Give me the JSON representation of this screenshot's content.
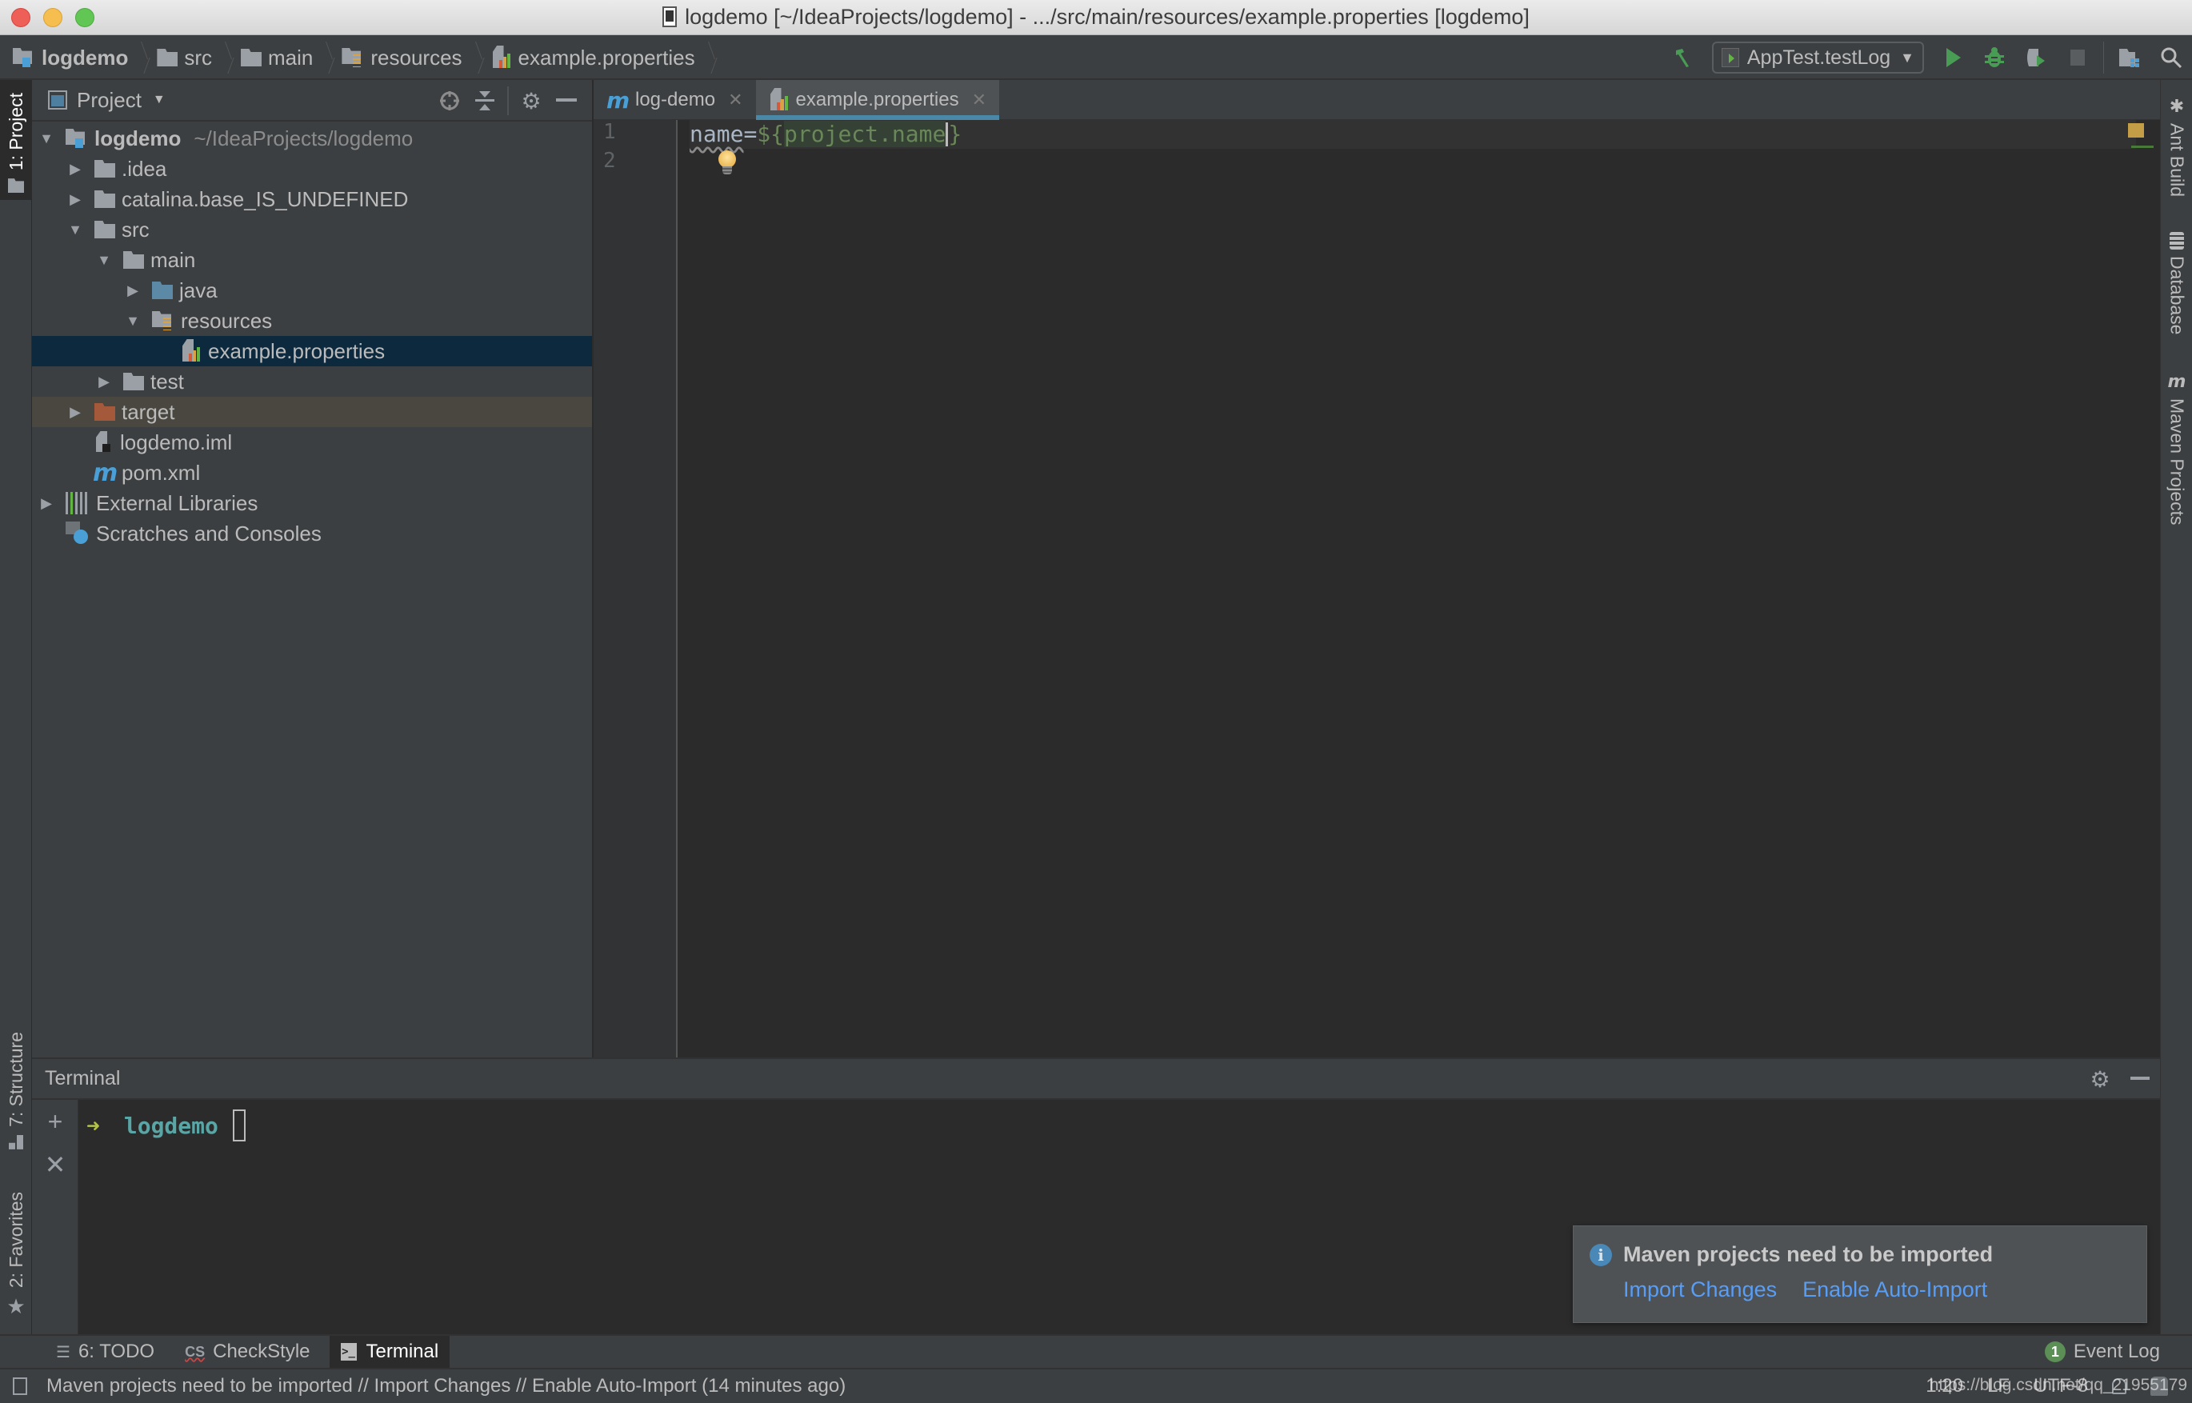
{
  "window": {
    "title": "logdemo [~/IdeaProjects/logdemo] - .../src/main/resources/example.properties [logdemo]"
  },
  "navbar": {
    "breadcrumbs": [
      {
        "label": "logdemo",
        "icon": "module-folder-icon"
      },
      {
        "label": "src",
        "icon": "folder-icon"
      },
      {
        "label": "main",
        "icon": "folder-icon"
      },
      {
        "label": "resources",
        "icon": "resources-folder-icon"
      },
      {
        "label": "example.properties",
        "icon": "properties-file-icon"
      }
    ],
    "run_config": "AppTest.testLog",
    "tools": [
      "build-hammer-icon",
      "run-icon",
      "debug-icon",
      "coverage-icon",
      "stop-icon",
      "project-structure-icon",
      "search-icon"
    ]
  },
  "left_strip": {
    "top_tab": "1: Project",
    "bottom_tabs": [
      "7: Structure",
      "2: Favorites"
    ]
  },
  "right_strip": {
    "tabs": [
      "Ant Build",
      "Database",
      "Maven Projects"
    ]
  },
  "project_panel": {
    "title": "Project",
    "tree": [
      {
        "label": "logdemo",
        "path": "~/IdeaProjects/logdemo",
        "depth": 0,
        "expanded": true,
        "icon": "module-folder-icon"
      },
      {
        "label": ".idea",
        "depth": 1,
        "expanded": false,
        "icon": "folder-icon"
      },
      {
        "label": "catalina.base_IS_UNDEFINED",
        "depth": 1,
        "expanded": false,
        "icon": "folder-icon"
      },
      {
        "label": "src",
        "depth": 1,
        "expanded": true,
        "icon": "folder-icon"
      },
      {
        "label": "main",
        "depth": 2,
        "expanded": true,
        "icon": "folder-icon"
      },
      {
        "label": "java",
        "depth": 3,
        "expanded": false,
        "icon": "source-folder-icon"
      },
      {
        "label": "resources",
        "depth": 3,
        "expanded": true,
        "icon": "resources-folder-icon"
      },
      {
        "label": "example.properties",
        "depth": 4,
        "icon": "properties-file-icon",
        "selected": true
      },
      {
        "label": "test",
        "depth": 2,
        "expanded": false,
        "icon": "folder-icon"
      },
      {
        "label": "target",
        "depth": 1,
        "expanded": false,
        "icon": "excluded-folder-icon"
      },
      {
        "label": "logdemo.iml",
        "depth": 1,
        "icon": "iml-file-icon"
      },
      {
        "label": "pom.xml",
        "depth": 1,
        "icon": "maven-icon"
      },
      {
        "label": "External Libraries",
        "depth": 0,
        "expanded": false,
        "icon": "libraries-icon"
      },
      {
        "label": "Scratches and Consoles",
        "depth": 0,
        "icon": "scratches-icon"
      }
    ]
  },
  "editor": {
    "tabs": [
      {
        "label": "log-demo",
        "icon": "maven-icon",
        "active": false
      },
      {
        "label": "example.properties",
        "icon": "properties-file-icon",
        "active": true
      }
    ],
    "lines": [
      {
        "number": "1",
        "key": "name",
        "eq": "=",
        "val_prefix": "${",
        "val_highlight": "project.name",
        "val_suffix": "}"
      },
      {
        "number": "2"
      }
    ]
  },
  "terminal": {
    "title": "Terminal",
    "prompt_arrow": "➜",
    "prompt_dir": "logdemo"
  },
  "notification": {
    "title": "Maven projects need to be imported",
    "links": [
      "Import Changes",
      "Enable Auto-Import"
    ]
  },
  "bottom_tabs": [
    {
      "label": "6: TODO",
      "icon": "todo-list-icon",
      "active": false
    },
    {
      "label": "CheckStyle",
      "icon": "checkstyle-icon",
      "active": false
    },
    {
      "label": "Terminal",
      "icon": "terminal-icon",
      "active": true
    }
  ],
  "event_log": {
    "label": "Event Log",
    "count": "1"
  },
  "statusbar": {
    "message": "Maven projects need to be imported // Import Changes // Enable Auto-Import (14 minutes ago)",
    "position": "1:20",
    "line_separator": "LF",
    "encoding": "UTF-8",
    "watermark": "https://blog.csdn.net/qq_21955179"
  },
  "colors": {
    "accent": "#4a88a8",
    "link": "#589df6",
    "selection": "#0d293e",
    "run_green": "#499c54"
  }
}
